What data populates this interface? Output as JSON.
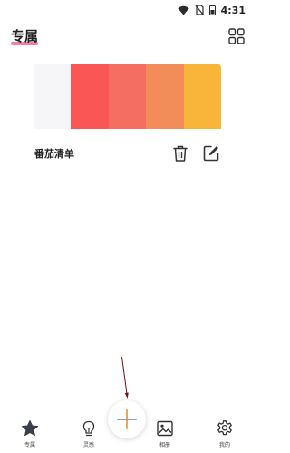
{
  "status_bar": {
    "time": "4:31",
    "icons": [
      "wifi-icon",
      "no-sim-icon",
      "battery-icon"
    ]
  },
  "header": {
    "title": "专属",
    "accent_color": "#f2679a",
    "menu_icon": "grid-icon"
  },
  "card": {
    "swatches": [
      "#fb5656",
      "#f56e62",
      "#f28c58",
      "#f8b53a"
    ]
  },
  "list_item": {
    "title": "番茄清单",
    "actions": [
      "trash-icon",
      "edit-icon"
    ]
  },
  "bottom_nav": {
    "items": [
      {
        "label": "专属",
        "icon": "star-icon",
        "active": true
      },
      {
        "label": "灵感",
        "icon": "lightbulb-icon",
        "active": false
      },
      {
        "label": "相册",
        "icon": "image-icon",
        "active": false
      },
      {
        "label": "我的",
        "icon": "gear-icon",
        "active": false
      }
    ],
    "fab_icon": "plus-icon"
  }
}
